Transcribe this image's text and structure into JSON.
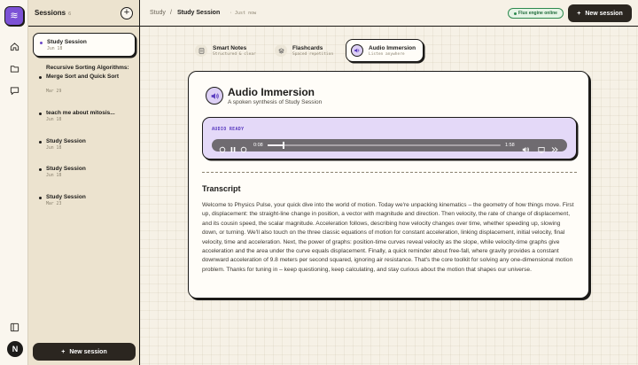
{
  "rail": {
    "logo_glyph": "≋",
    "icons": [
      "home-icon",
      "folder-icon",
      "chat-icon"
    ],
    "bottom_icon": "panel-icon",
    "avatar_initial": "N"
  },
  "sidebar": {
    "title": "Sessions",
    "count": "6",
    "new_label": "New session",
    "items": [
      {
        "title": "Study Session",
        "date": "Jun 18"
      },
      {
        "title": "Recursive Sorting Algorithms: Merge Sort and Quick Sort",
        "date": "Mar 29"
      },
      {
        "title": "teach me about mitosis...",
        "date": "Jun 18"
      },
      {
        "title": "Study Session",
        "date": "Jun 18"
      },
      {
        "title": "Study Session",
        "date": "Jun 18"
      },
      {
        "title": "Study Session",
        "date": "Mar 23"
      }
    ]
  },
  "header": {
    "breadcrumb_root": "Study",
    "breadcrumb_sep": "/",
    "breadcrumb_current": "Study Session",
    "timestamp": "· Just now",
    "engine_status": "Flux engine online",
    "new_label": "New session"
  },
  "tabs": [
    {
      "label": "Smart Notes",
      "sub": "Structured & clear",
      "icon": "notes-icon",
      "active": false
    },
    {
      "label": "Flashcards",
      "sub": "Spaced repetition",
      "icon": "stack-icon",
      "active": false
    },
    {
      "label": "Audio Immersion",
      "sub": "Listen anywhere",
      "icon": "speaker-icon",
      "active": true
    }
  ],
  "panel": {
    "title": "Audio Immersion",
    "subtitle": "A spoken synthesis of Study Session",
    "player": {
      "status": "AUDIO READY",
      "current_time": "0:08",
      "duration": "1:58",
      "progress": 0.068
    },
    "transcript_title": "Transcript",
    "transcript": "Welcome to Physics Pulse, your quick dive into the world of motion. Today we're unpacking kinematics – the geometry of how things move. First up, displacement: the straight-line change in position, a vector with magnitude and direction. Then velocity, the rate of change of displacement, and its cousin speed, the scalar magnitude. Acceleration follows, describing how velocity changes over time, whether speeding up, slowing down, or turning. We'll also touch on the three classic equations of motion for constant acceleration, linking displacement, initial velocity, final velocity, time and acceleration. Next, the power of graphs: position-time curves reveal velocity as the slope, while velocity-time graphs give acceleration and the area under the curve equals displacement. Finally, a quick reminder about free-fall, where gravity provides a constant downward acceleration of 9.8 meters per second squared, ignoring air resistance. That's the core toolkit for solving any one-dimensional motion problem. Thanks for tuning in – keep questioning, keep calculating, and stay curious about the motion that shapes our universe."
  },
  "colors": {
    "accent": "#7c52d6",
    "player_bg": "#e4d9f8",
    "dark": "#1c1b19",
    "online": "#2e8a4e"
  }
}
